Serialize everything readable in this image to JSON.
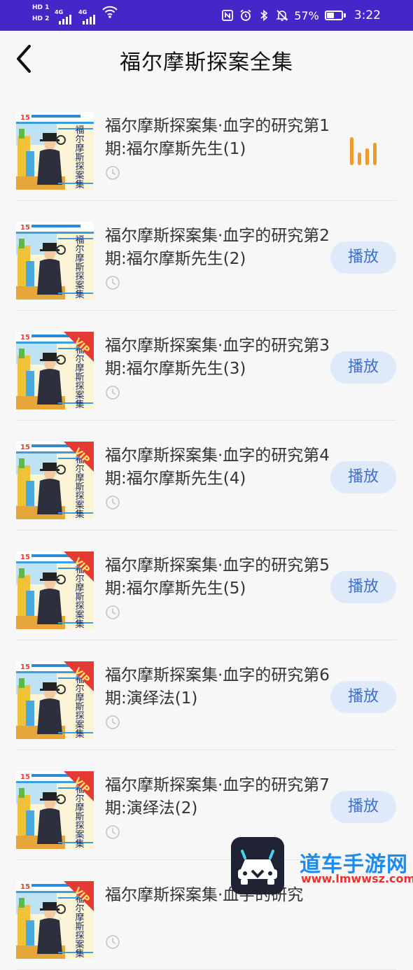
{
  "status_bar": {
    "hd1": "HD 1",
    "hd2": "HD 2",
    "net1": "4G",
    "net2": "4G",
    "battery_percent": "57%",
    "battery_level": 0.57,
    "time": "3:22",
    "icons": [
      "nfc-icon",
      "alarm-icon",
      "bluetooth-icon",
      "mute-icon",
      "wifi-icon"
    ]
  },
  "header": {
    "title": "福尔摩斯探案全集",
    "back_icon": "chevron-left-icon"
  },
  "episodes": [
    {
      "title": "福尔摩斯探案集·血字的研究第1期:福尔摩斯先生(1)",
      "vip": false,
      "playing": true,
      "action": ""
    },
    {
      "title": "福尔摩斯探案集·血字的研究第2期:福尔摩斯先生(2)",
      "vip": false,
      "playing": false,
      "action": "播放"
    },
    {
      "title": "福尔摩斯探案集·血字的研究第3期:福尔摩斯先生(3)",
      "vip": true,
      "playing": false,
      "action": "播放"
    },
    {
      "title": "福尔摩斯探案集·血字的研究第4期:福尔摩斯先生(4)",
      "vip": true,
      "playing": false,
      "action": "播放"
    },
    {
      "title": "福尔摩斯探案集·血字的研究第5期:福尔摩斯先生(5)",
      "vip": true,
      "playing": false,
      "action": "播放"
    },
    {
      "title": "福尔摩斯探案集·血字的研究第6期:演绎法(1)",
      "vip": true,
      "playing": false,
      "action": "播放"
    },
    {
      "title": "福尔摩斯探案集·血字的研究第7期:演绎法(2)",
      "vip": true,
      "playing": false,
      "action": "播放"
    },
    {
      "title": "福尔摩斯探案集·血字的研究",
      "vip": true,
      "playing": false,
      "action": ""
    }
  ],
  "cover": {
    "spine_text": "福尔摩斯探案集",
    "vip_label": "VIP"
  },
  "watermark": {
    "title": "道车手游网",
    "url": "www.lmwwsz.com"
  },
  "colors": {
    "status_bar": "#4527c9",
    "play_button_bg": "#dee9f9",
    "play_button_text": "#3d6fd1",
    "playing_indicator": "#f09a2c",
    "vip_ribbon": "#e53935"
  }
}
